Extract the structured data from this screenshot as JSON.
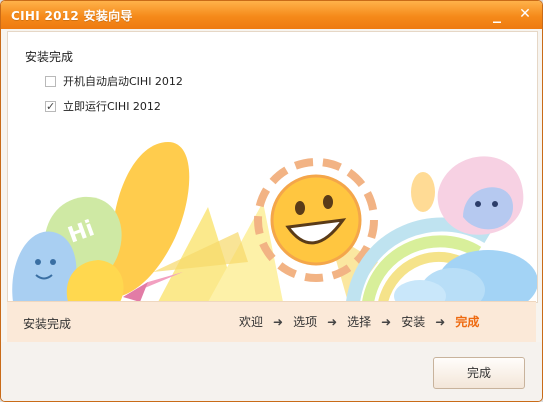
{
  "window": {
    "title": "CIHI 2012 安装向导",
    "minimize_glyph": "_",
    "close_glyph": "✕"
  },
  "content": {
    "section_title": "安装完成",
    "options": [
      {
        "label": "开机自动启动CIHI 2012",
        "checked": false
      },
      {
        "label": "立即运行CIHI 2012",
        "checked": true
      }
    ],
    "artwork_text": "Hi"
  },
  "statusbar": {
    "left": "安装完成",
    "steps": [
      "欢迎",
      "选项",
      "选择",
      "安装",
      "完成"
    ],
    "arrow": "➜",
    "active_step": "完成"
  },
  "footer": {
    "finish_label": "完成"
  },
  "colors": {
    "accent": "#f58a1a",
    "active_step": "#ee6a10",
    "title_text": "#ffffff"
  }
}
